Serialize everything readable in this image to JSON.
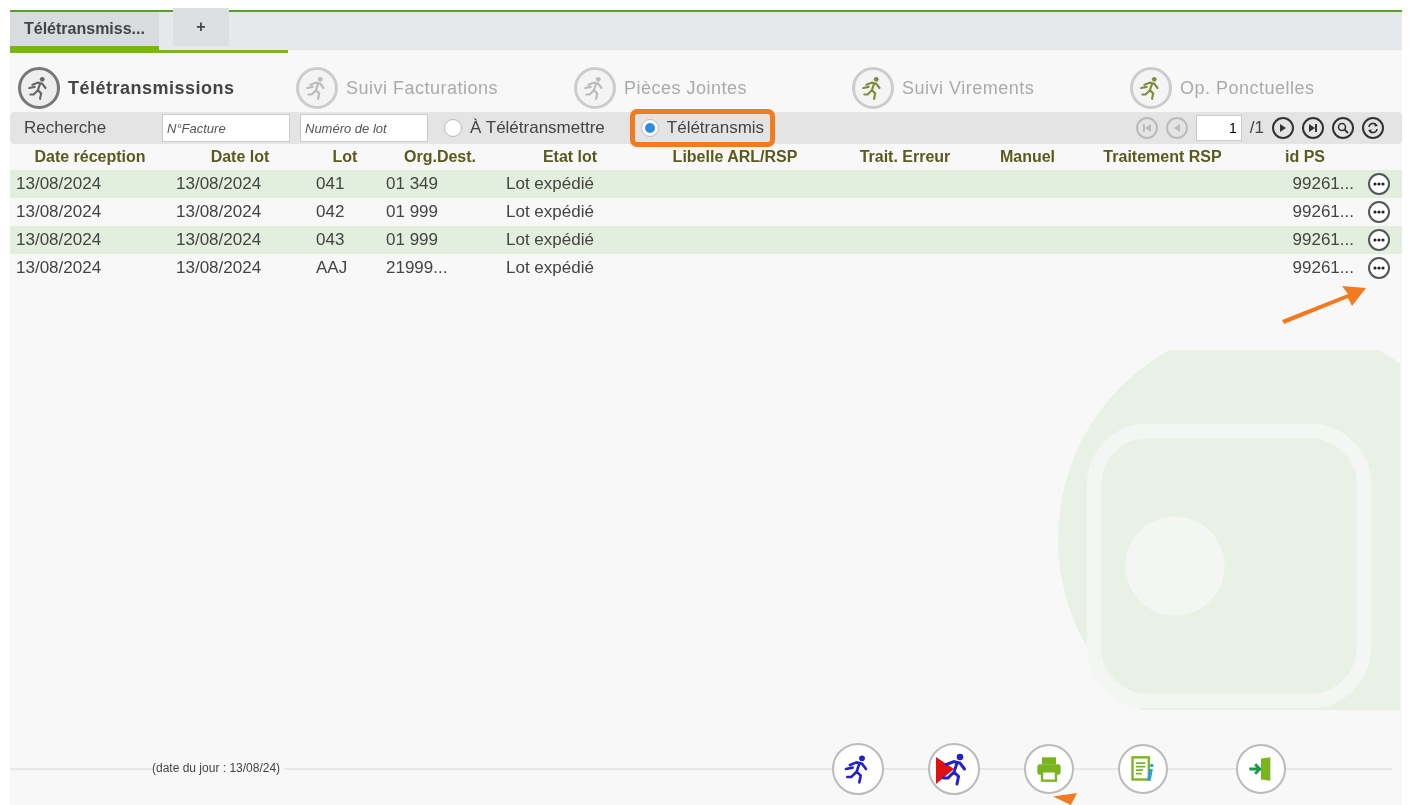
{
  "tabs": [
    {
      "label": "Télétransmiss...",
      "selected": true
    },
    {
      "label": "+",
      "selected": false
    }
  ],
  "modules": [
    {
      "label": "Télétransmissions",
      "selected": true
    },
    {
      "label": "Suivi Facturations",
      "selected": false
    },
    {
      "label": "Pièces Jointes",
      "selected": false
    },
    {
      "label": "Suivi Virements",
      "selected": false
    },
    {
      "label": "Op. Ponctuelles",
      "selected": false
    }
  ],
  "search": {
    "label": "Recherche",
    "invoice_field": {
      "placeholder": "N°Facture"
    },
    "batch_field": {
      "placeholder": "Numéro de lot"
    },
    "radios": [
      {
        "label": "À Télétransmettre",
        "selected": false,
        "highlighted": false
      },
      {
        "label": "Télétransmis",
        "selected": true,
        "highlighted": true
      }
    ]
  },
  "pager": {
    "page": "1",
    "total": "/1",
    "first_disabled": true,
    "prev_disabled": true
  },
  "table": {
    "columns": [
      "Date réception",
      "Date lot",
      "Lot",
      "Org.Dest.",
      "Etat lot",
      "Libelle ARL/RSP",
      "Trait. Erreur",
      "Manuel",
      "Traitement RSP",
      "id PS"
    ],
    "rows": [
      {
        "cells": [
          "13/08/2024",
          "13/08/2024",
          "041",
          "01 349",
          "Lot expédié",
          "",
          "",
          "",
          "",
          "99261..."
        ]
      },
      {
        "cells": [
          "13/08/2024",
          "13/08/2024",
          "042",
          "01 999",
          "Lot expédié",
          "",
          "",
          "",
          "",
          "99261..."
        ]
      },
      {
        "cells": [
          "13/08/2024",
          "13/08/2024",
          "043",
          "01 999",
          "Lot expédié",
          "",
          "",
          "",
          "",
          "99261..."
        ]
      },
      {
        "cells": [
          "13/08/2024",
          "13/08/2024",
          "AAJ",
          "21999...",
          "Lot expédié",
          "",
          "",
          "",
          "",
          "99261..."
        ]
      }
    ]
  },
  "footer": {
    "date_note": "(date du jour : 13/08/24)"
  }
}
